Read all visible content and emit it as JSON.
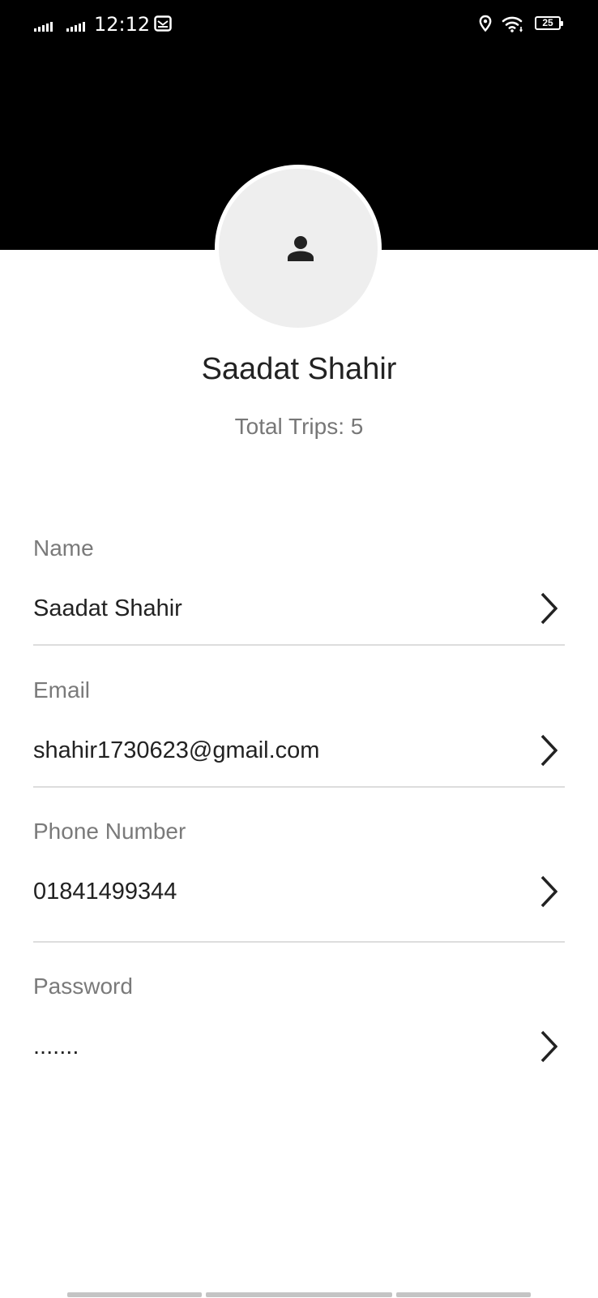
{
  "status_bar": {
    "time": "12:12",
    "battery": "25"
  },
  "profile": {
    "name": "Saadat Shahir",
    "trips": "Total Trips: 5"
  },
  "fields": [
    {
      "label": "Name",
      "value": "Saadat Shahir"
    },
    {
      "label": "Email",
      "value": "shahir1730623@gmail.com"
    },
    {
      "label": "Phone Number",
      "value": "01841499344"
    },
    {
      "label": "Password",
      "value": "......."
    }
  ],
  "icons": {
    "avatar": "person-icon",
    "row_action": "chevron-right-icon",
    "status": [
      "signal-icon",
      "signal-icon",
      "mail-icon",
      "location-icon",
      "wifi-icon",
      "battery-icon"
    ]
  },
  "colors": {
    "header_bg": "#000000",
    "page_bg": "#ffffff",
    "avatar_bg": "#eeeeee",
    "label": "#7a7a7a",
    "value": "#222222",
    "divider": "#dddddd"
  }
}
